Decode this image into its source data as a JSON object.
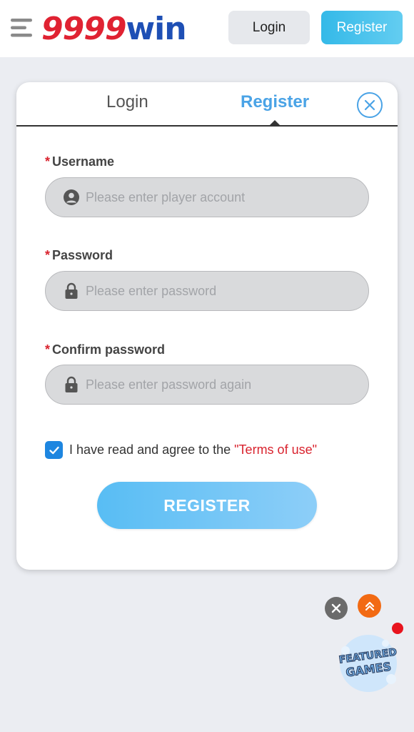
{
  "header": {
    "logo": {
      "number": "9999",
      "word": "win"
    },
    "login_label": "Login",
    "register_label": "Register"
  },
  "modal": {
    "tabs": {
      "login": "Login",
      "register": "Register",
      "active": "register"
    },
    "fields": {
      "username": {
        "required": "*",
        "label": "Username",
        "placeholder": "Please enter player account"
      },
      "password": {
        "required": "*",
        "label": "Password",
        "placeholder": "Please enter password"
      },
      "confirm": {
        "required": "*",
        "label": "Confirm password",
        "placeholder": "Please enter password again"
      }
    },
    "agree": {
      "checked": true,
      "text": "I have read and agree to the",
      "link": "\"Terms of use\""
    },
    "submit_label": "REGISTER"
  },
  "floating": {
    "featured": {
      "line1": "FEATURED",
      "line2": "GAMES"
    }
  },
  "colors": {
    "accent": "#4aa3e6",
    "brand_red": "#e02232",
    "brand_blue": "#1e4fb5",
    "required": "#d9232e"
  }
}
